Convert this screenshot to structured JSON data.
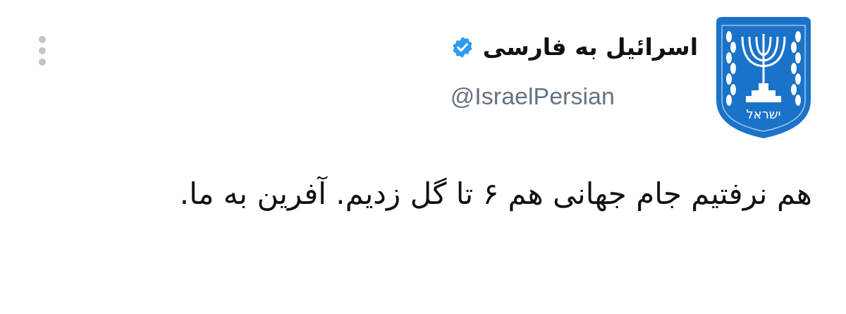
{
  "author": {
    "name": "اسرائیل به فارسی",
    "verified": true,
    "handle": "@IsraelPersian",
    "avatar_text": "ישראל"
  },
  "tweet": {
    "text": "هم نرفتیم جام جهانی هم ۶ تا گل زدیم. آفرین به ما."
  }
}
